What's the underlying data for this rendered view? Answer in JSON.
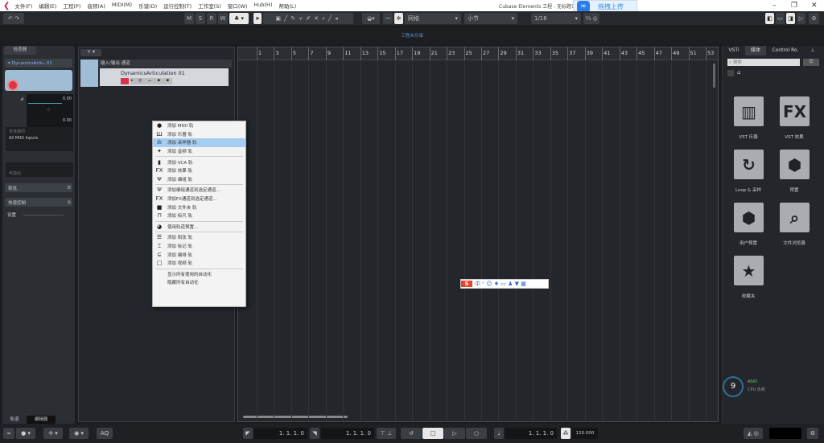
{
  "app": {
    "title": "Cubase Elements 工程 - 无标题1",
    "menu": [
      "文件(F)",
      "编辑(E)",
      "工程(P)",
      "音频(A)",
      "MIDI(M)",
      "乐谱(D)",
      "运行控制(T)",
      "工作室(S)",
      "窗口(W)",
      "Hub(H)",
      "帮助(L)"
    ],
    "upload_label": "拖拽上传"
  },
  "toolbar": {
    "msrw": [
      "M",
      "S",
      "R",
      "W"
    ],
    "snap_mode": "网格",
    "grid_type": "小节",
    "quantize": "1/16"
  },
  "infoline": "工程未存储",
  "inspector": {
    "tab": "检查器",
    "track_name": "DynamicsArtic..01",
    "vol": "0.00",
    "pan": "C",
    "delay": "0.00",
    "input": "未连接的",
    "midi_input": "All MIDI Inputs",
    "routing": "未指派",
    "section_notes": "和弦",
    "section_quick": "快速控制",
    "section_extra": "设置"
  },
  "tracklist": {
    "header": "输入/输出 通道",
    "track_name": "DynamicsArticulation 01"
  },
  "ruler": {
    "bars": [
      1,
      3,
      5,
      7,
      9,
      11,
      13,
      15,
      17,
      19,
      21,
      23,
      25,
      27,
      29,
      31,
      33,
      35,
      37,
      39,
      41,
      43,
      45,
      47,
      49,
      51,
      53
    ]
  },
  "context_menu": {
    "items": [
      {
        "icon": "midi-icon",
        "glyph": "●",
        "label": "添加 MIDI 轨"
      },
      {
        "icon": "instrument-icon",
        "glyph": "Ш",
        "label": "添加 乐器 轨"
      },
      {
        "icon": "sampler-icon",
        "glyph": "ılı",
        "label": "添加 采样器 轨",
        "highlight": true
      },
      {
        "icon": "audio-icon",
        "glyph": "✦",
        "label": "添加 音频 轨",
        "sep": true
      },
      {
        "icon": "vca-icon",
        "glyph": "▮",
        "label": "添加 VCA 轨"
      },
      {
        "icon": "fx-icon",
        "glyph": "FX",
        "label": "添加 效果 轨"
      },
      {
        "icon": "group-icon",
        "glyph": "Ψ",
        "label": "添加 编组 轨",
        "sep": true
      },
      {
        "icon": "group-icon",
        "glyph": "Ψ",
        "label": "添加编组通道到选定通道..."
      },
      {
        "icon": "fx-icon",
        "glyph": "FX",
        "label": "添加FX通道到选定通道..."
      },
      {
        "icon": "folder-icon",
        "glyph": "■",
        "label": "添加 文件夹 轨"
      },
      {
        "icon": "ruler-icon",
        "glyph": "⊓",
        "label": "添加 标尺 轨",
        "sep": true
      },
      {
        "icon": "track-preset-icon",
        "glyph": "◕",
        "label": "使用轨道预置...",
        "sep": true
      },
      {
        "icon": "chord-icon",
        "glyph": "☰",
        "label": "添加 和弦 轨"
      },
      {
        "icon": "marker-icon",
        "glyph": "⌶",
        "label": "添加 标记 轨"
      },
      {
        "icon": "arranger-icon",
        "glyph": "⊆",
        "label": "添加 编排 轨"
      },
      {
        "icon": "video-icon",
        "glyph": "□",
        "label": "添加 视频 轨",
        "sep": true
      },
      {
        "icon": "",
        "glyph": "",
        "label": "显示所有使用的自动化"
      },
      {
        "icon": "",
        "glyph": "",
        "label": "隐藏所有自动化"
      }
    ]
  },
  "rpanel": {
    "tabs": [
      "VSTi",
      "媒体",
      "Control Ro."
    ],
    "search_placeholder": "搜索",
    "tiles": [
      {
        "icon": "piano-icon",
        "glyph": "▥",
        "label": "VST 乐器"
      },
      {
        "icon": "fx-icon",
        "glyph": "FX",
        "label": "VST 效果"
      },
      {
        "icon": "loop-icon",
        "glyph": "↻",
        "label": "Loop & 采样"
      },
      {
        "icon": "presets-icon",
        "glyph": "⬢",
        "label": "预置"
      },
      {
        "icon": "user-presets-icon",
        "glyph": "⬢",
        "label": "用户预置"
      },
      {
        "icon": "file-browser-icon",
        "glyph": "⌕",
        "label": "文件浏览器"
      },
      {
        "icon": "star-icon",
        "glyph": "★",
        "label": "收藏夹"
      }
    ],
    "cpu_value": "9",
    "cpu_label": "CPU 负荷",
    "asio": "ASIO"
  },
  "bottom_tabs": [
    "轨道",
    "编辑器"
  ],
  "transport": {
    "left_locator": "1. 1. 1.  0",
    "right_locator": "1. 1. 1.  0",
    "position": "1. 1. 1.  0",
    "tempo": "120.000",
    "aq": "AQ"
  },
  "colors": {
    "accent": "#a6cdf2",
    "record": "#d9344a",
    "brand": "#c0282d"
  }
}
